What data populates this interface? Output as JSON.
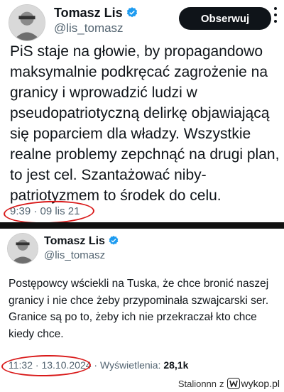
{
  "tweet1": {
    "name": "Tomasz Lis",
    "handle": "@lis_tomasz",
    "follow_label": "Obserwuj",
    "text": "PiS staje na głowie, by propagandowo maksymalnie podkręcać zagrożenie na granicy i wprowadzić ludzi w pseudopatriotyczną delirkę objawiającą się  poparciem dla władzy. Wszystkie realne problemy zepchnąć na drugi plan, to jest cel. Szantażować niby-patriotyzmem to środek do celu.",
    "time": "9:39",
    "separator": "·",
    "date": "09 lis 21"
  },
  "tweet2": {
    "name": "Tomasz Lis",
    "handle": "@lis_tomasz",
    "text": "Postępowcy wściekli na Tuska, że chce bronić naszej granicy i nie chce żeby przypominała szwajcarski  ser. Granice są po to, żeby ich nie przekraczał kto  chce kiedy chce.",
    "time": "11:32",
    "separator": "·",
    "date": "13.10.2024",
    "views_label": "Wyświetlenia:",
    "views_value": "28,1k"
  },
  "watermark": {
    "user": "Stalionnn",
    "joiner": "z",
    "site": "wykop.pl"
  },
  "colors": {
    "verified": "#1d9bf0",
    "annotation": "#d91a1a",
    "follow_bg": "#0f1419"
  },
  "icons": [
    "verified-badge-icon",
    "more-options-icon",
    "wykop-logo-icon"
  ]
}
